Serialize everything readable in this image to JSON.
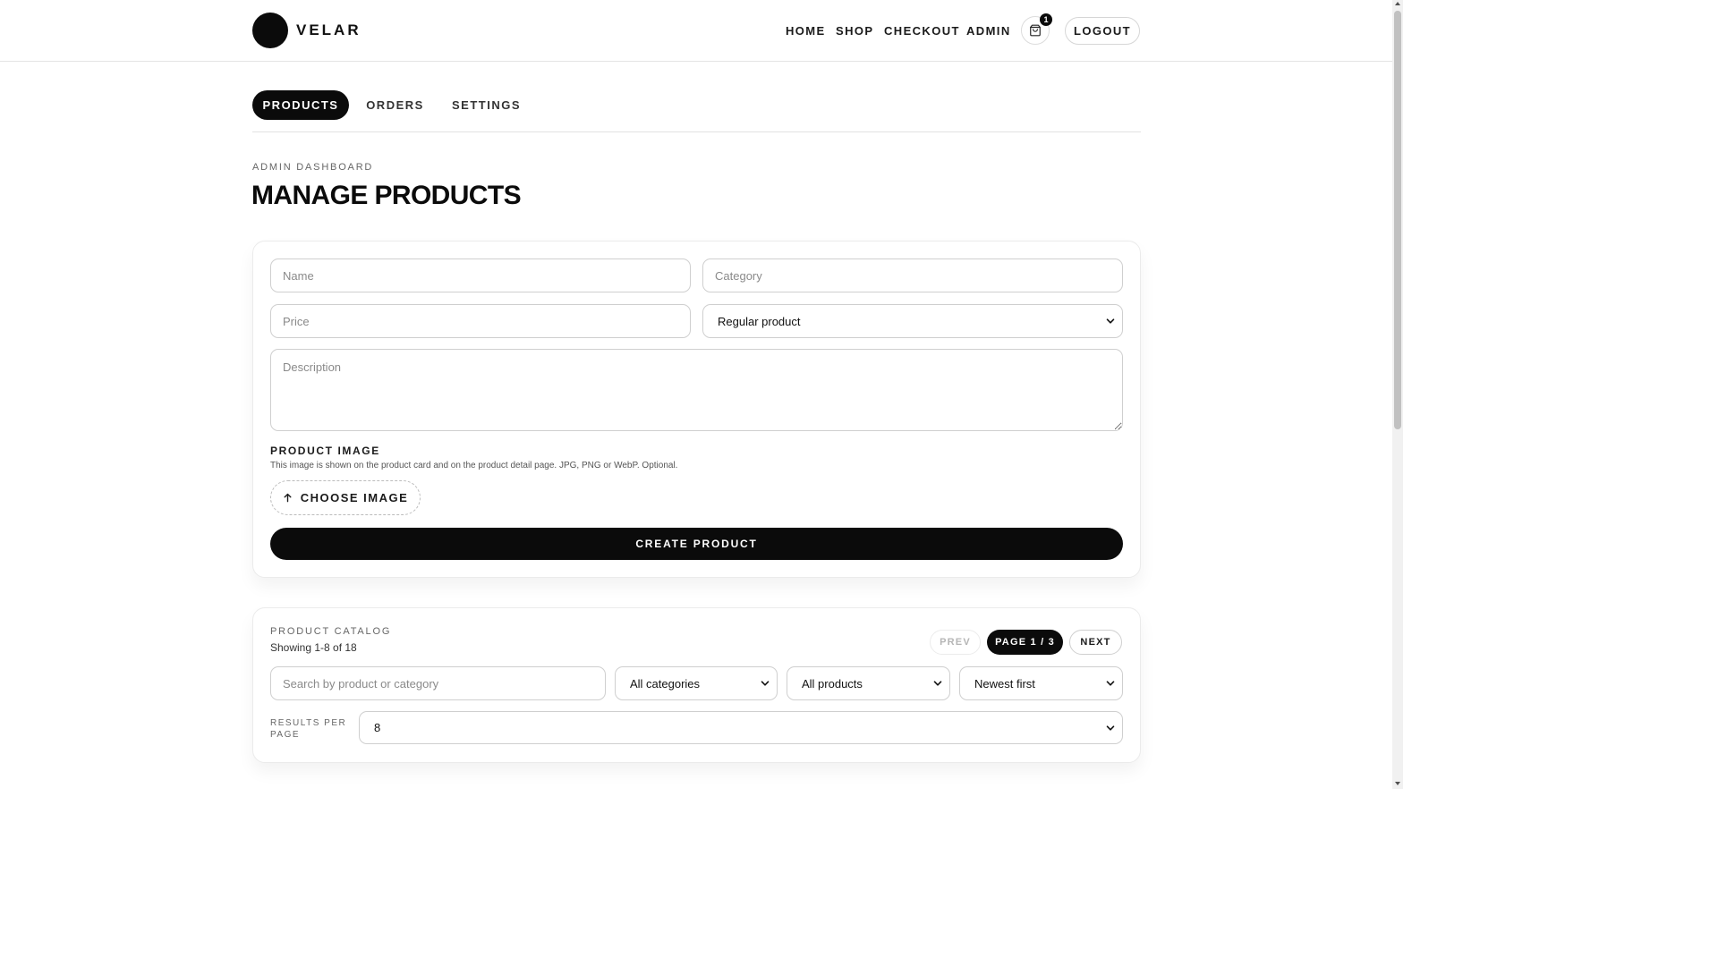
{
  "brand": {
    "name": "VELAR"
  },
  "nav": {
    "home": "HOME",
    "shop": "SHOP",
    "checkout": "CHECKOUT",
    "admin": "ADMIN",
    "cart_count": "1",
    "logout": "LOGOUT"
  },
  "tabs": [
    {
      "label": "PRODUCTS",
      "active": true
    },
    {
      "label": "ORDERS",
      "active": false
    },
    {
      "label": "SETTINGS",
      "active": false
    }
  ],
  "header": {
    "eyebrow": "ADMIN DASHBOARD",
    "title": "MANAGE PRODUCTS"
  },
  "form": {
    "name_placeholder": "Name",
    "category_placeholder": "Category",
    "price_placeholder": "Price",
    "product_type_value": "Regular product",
    "description_placeholder": "Description",
    "image_label": "PRODUCT IMAGE",
    "image_hint": "This image is shown on the product card and on the product detail page. JPG, PNG or WebP. Optional.",
    "choose_image": "CHOOSE IMAGE",
    "create_button": "CREATE PRODUCT"
  },
  "catalog": {
    "eyebrow": "PRODUCT CATALOG",
    "showing": "Showing 1-8 of 18",
    "prev": "PREV",
    "page": "PAGE 1 / 3",
    "next": "NEXT",
    "search_placeholder": "Search by product or category",
    "category_filter": "All categories",
    "product_filter": "All products",
    "sort": "Newest first",
    "results_per_page_label": "RESULTS PER PAGE",
    "results_per_page": "8"
  },
  "colors": {
    "primary": "#0b0b0b",
    "background": "#ffffff",
    "border": "#cfcfcf",
    "muted_text": "#666666"
  }
}
